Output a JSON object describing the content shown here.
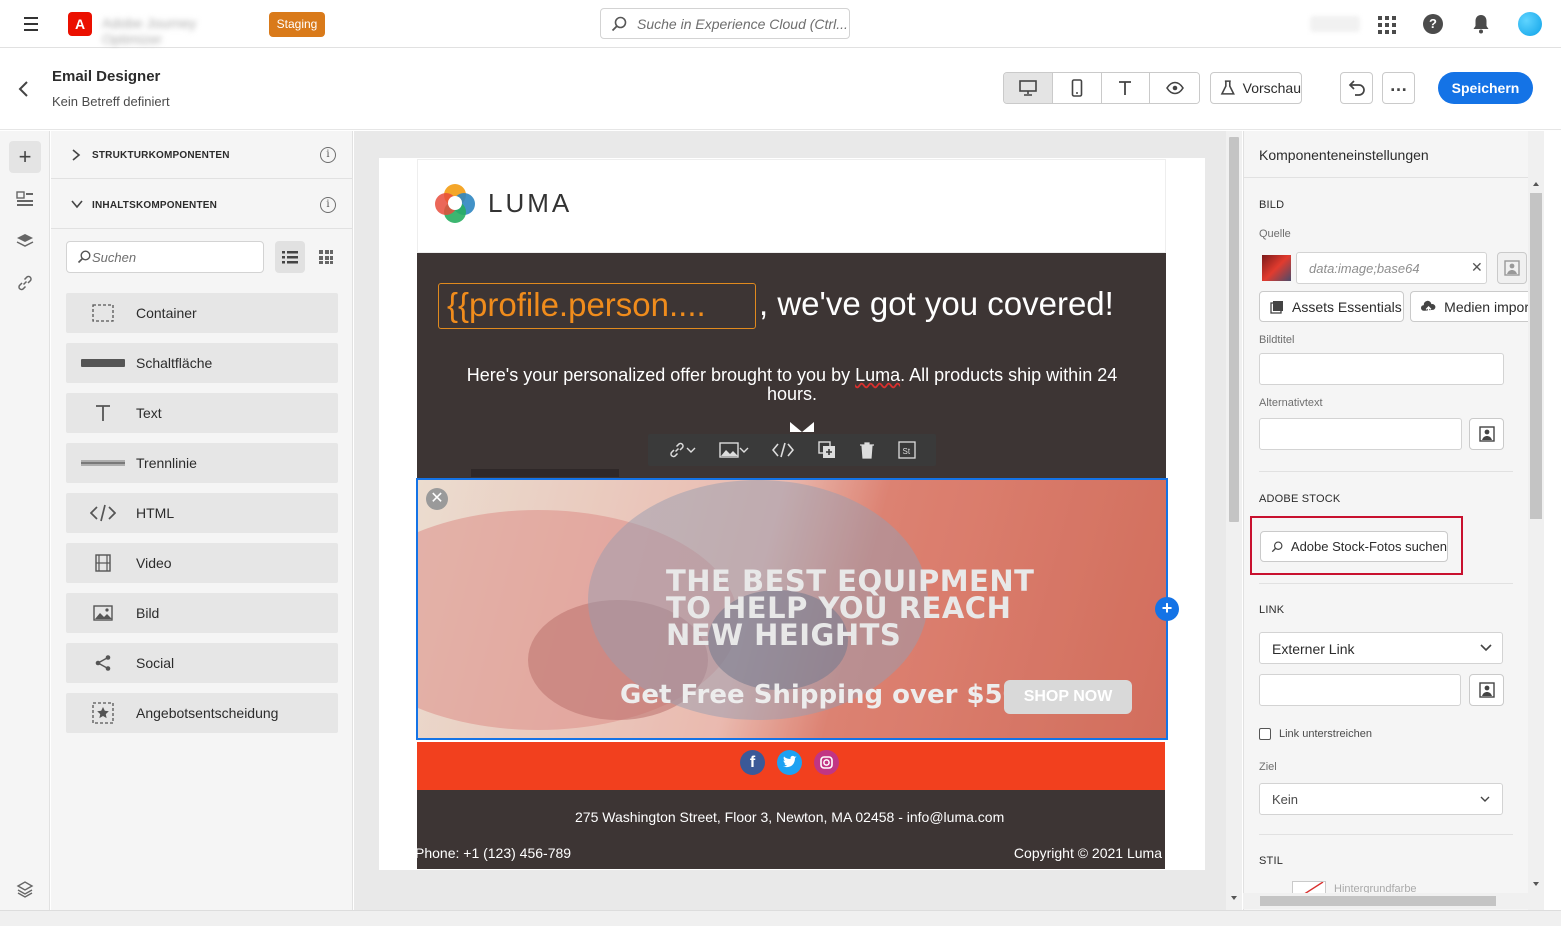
{
  "topbar": {
    "logo_letter": "A",
    "app_name": "Adobe Journey Optimizer",
    "env_badge": "Staging",
    "search_placeholder": "Suche in Experience Cloud (Ctrl..."
  },
  "header": {
    "title": "Email Designer",
    "subtitle": "Kein Betreff definiert",
    "preview_label": "Vorschau",
    "save_label": "Speichern",
    "more_label": "…"
  },
  "components": {
    "section_structure": "STRUKTURKOMPONENTEN",
    "section_content": "INHALTSKOMPONENTEN",
    "search_placeholder": "Suchen",
    "items": [
      {
        "label": "Container",
        "icon": "container-icon"
      },
      {
        "label": "Schaltfläche",
        "icon": "button-icon"
      },
      {
        "label": "Text",
        "icon": "text-icon"
      },
      {
        "label": "Trennlinie",
        "icon": "divider-icon"
      },
      {
        "label": "HTML",
        "icon": "html-icon"
      },
      {
        "label": "Video",
        "icon": "video-icon"
      },
      {
        "label": "Bild",
        "icon": "image-icon"
      },
      {
        "label": "Social",
        "icon": "share-icon"
      },
      {
        "label": "Angebotsentscheidung",
        "icon": "offer-decision-icon"
      }
    ]
  },
  "email": {
    "brand": "LUMA",
    "token": "{{profile.person....",
    "headline": ", we've got you covered!",
    "subcopy_before": "Here's your personalized offer brought to you by ",
    "subcopy_brand": "Luma",
    "subcopy_after": ". All products ship within 24 hours.",
    "banner_line1": "THE BEST EQUIPMENT",
    "banner_line2": "TO HELP YOU REACH",
    "banner_line3": "NEW HEIGHTS",
    "banner_shipping": "Get Free Shipping over $50",
    "banner_cta": "SHOP NOW",
    "address": "275 Washington Street, Floor 3, Newton, MA 02458 - info@luma.com",
    "phone": "Phone: +1 (123) 456-789",
    "copyright": "Copyright © 2021 Luma"
  },
  "settings": {
    "title": "Komponenteneinstellungen",
    "image_section": "BILD",
    "source_label": "Quelle",
    "source_value": "data:image;base64",
    "assets_button": "Assets Essentials",
    "import_button": "Medien impor",
    "image_title_label": "Bildtitel",
    "alt_text_label": "Alternativtext",
    "stock_section": "ADOBE STOCK",
    "stock_button": "Adobe Stock-Fotos suchen",
    "link_section": "LINK",
    "link_type": "Externer Link",
    "underline_label": "Link unterstreichen",
    "target_label": "Ziel",
    "target_value": "Kein",
    "style_section": "STIL",
    "bg_color_label": "Hintergrundfarbe"
  },
  "colors": {
    "accent": "#1473e6",
    "staging": "#d97a1a",
    "email_dark": "#3d3534",
    "email_orange": "#f2401e",
    "token_orange": "#f08c1c",
    "highlight_red": "#c8102e"
  }
}
